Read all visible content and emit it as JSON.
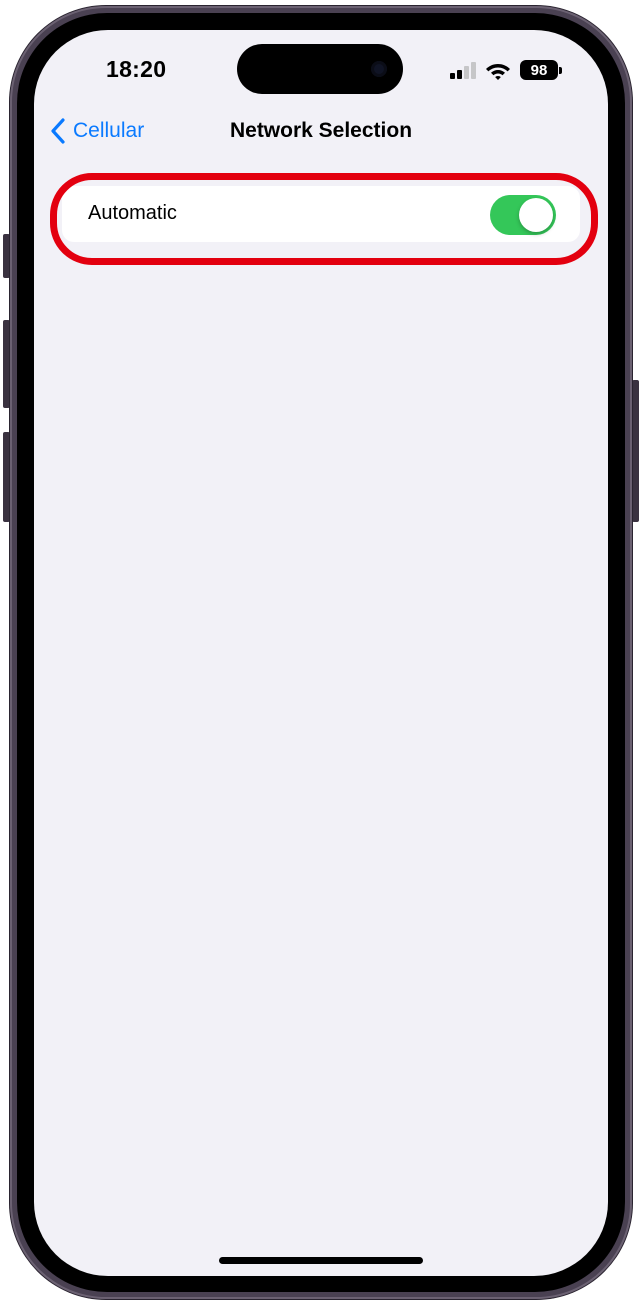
{
  "status_bar": {
    "time": "18:20",
    "battery": "98"
  },
  "nav": {
    "back_label": "Cellular",
    "title": "Network Selection"
  },
  "settings": {
    "automatic": {
      "label": "Automatic",
      "enabled": true
    }
  },
  "colors": {
    "accent": "#0a7aff",
    "toggle_on": "#34c759",
    "highlight": "#e3000f",
    "background": "#f2f1f7"
  },
  "icons": {
    "back": "chevron-left-icon",
    "signal": "cellular-signal-icon",
    "wifi": "wifi-icon",
    "battery": "battery-icon"
  }
}
